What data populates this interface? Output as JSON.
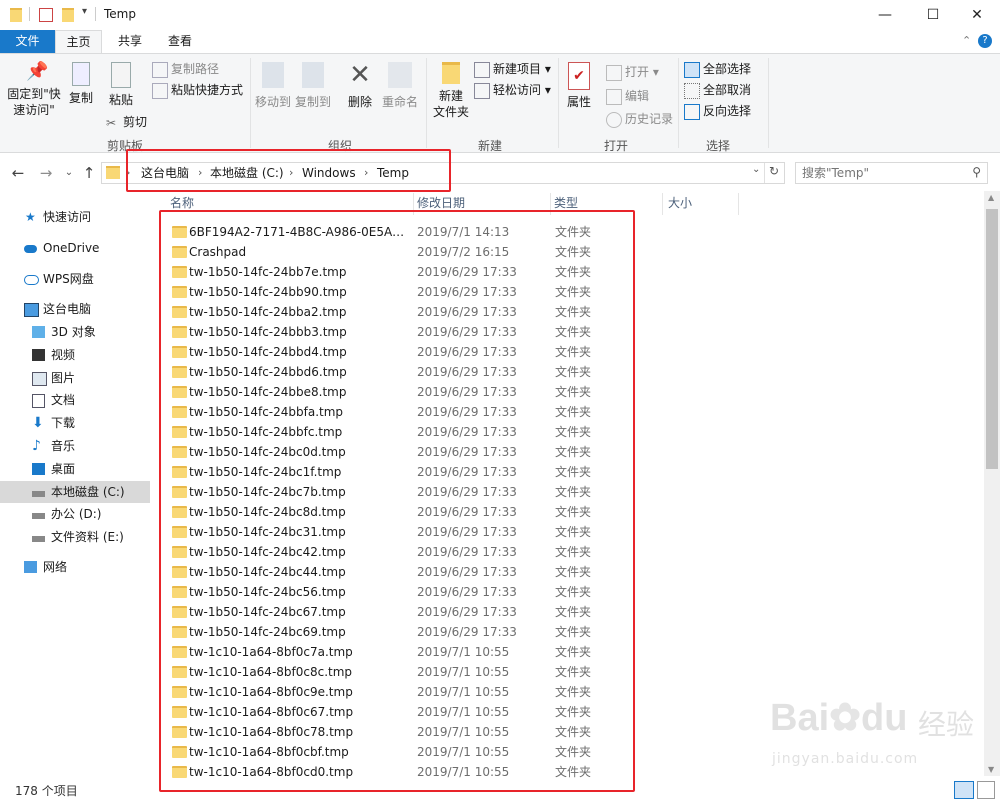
{
  "window": {
    "title": "Temp",
    "minimize": "—",
    "maximize": "☐",
    "close": "✕"
  },
  "tabs": {
    "file": "文件",
    "home": "主页",
    "share": "共享",
    "view": "查看"
  },
  "ribbon": {
    "pin": "固定到\"快\n速访问\"",
    "copy": "复制",
    "paste": "粘贴",
    "copy_path": "复制路径",
    "paste_shortcut": "粘贴快捷方式",
    "cut": "剪切",
    "clipboard": "剪贴板",
    "move_to": "移动到",
    "copy_to": "复制到",
    "delete": "删除",
    "rename": "重命名",
    "organize": "组织",
    "new_folder": "新建\n文件夹",
    "new_item": "新建项目",
    "easy_access": "轻松访问",
    "new_group": "新建",
    "properties": "属性",
    "open": "打开",
    "edit": "编辑",
    "history": "历史记录",
    "open_group": "打开",
    "select_all": "全部选择",
    "select_none": "全部取消",
    "invert_selection": "反向选择",
    "select_group": "选择"
  },
  "address": {
    "crumbs": [
      "这台电脑",
      "本地磁盘 (C:)",
      "Windows",
      "Temp"
    ],
    "search_placeholder": "搜索\"Temp\""
  },
  "sidebar": {
    "items": [
      {
        "label": "快速访问",
        "icon": "star-icon"
      },
      {
        "label": "OneDrive",
        "icon": "cloud-icon"
      },
      {
        "label": "WPS网盘",
        "icon": "wps-cloud-icon"
      },
      {
        "label": "这台电脑",
        "icon": "computer-icon"
      },
      {
        "label": "3D 对象",
        "icon": "cube-icon"
      },
      {
        "label": "视频",
        "icon": "video-icon"
      },
      {
        "label": "图片",
        "icon": "picture-icon"
      },
      {
        "label": "文档",
        "icon": "document-icon"
      },
      {
        "label": "下载",
        "icon": "download-icon"
      },
      {
        "label": "音乐",
        "icon": "music-icon"
      },
      {
        "label": "桌面",
        "icon": "desktop-icon"
      },
      {
        "label": "本地磁盘 (C:)",
        "icon": "drive-icon"
      },
      {
        "label": "办公 (D:)",
        "icon": "drive-icon"
      },
      {
        "label": "文件资料 (E:)",
        "icon": "drive-icon"
      },
      {
        "label": "网络",
        "icon": "network-icon"
      }
    ]
  },
  "columns": {
    "name": "名称",
    "modified": "修改日期",
    "type": "类型",
    "size": "大小"
  },
  "files": [
    {
      "name": "6BF194A2-7171-4B8C-A986-0E5A5AE...",
      "date": "2019/7/1 14:13",
      "type": "文件夹"
    },
    {
      "name": "Crashpad",
      "date": "2019/7/2 16:15",
      "type": "文件夹"
    },
    {
      "name": "tw-1b50-14fc-24bb7e.tmp",
      "date": "2019/6/29 17:33",
      "type": "文件夹"
    },
    {
      "name": "tw-1b50-14fc-24bb90.tmp",
      "date": "2019/6/29 17:33",
      "type": "文件夹"
    },
    {
      "name": "tw-1b50-14fc-24bba2.tmp",
      "date": "2019/6/29 17:33",
      "type": "文件夹"
    },
    {
      "name": "tw-1b50-14fc-24bbb3.tmp",
      "date": "2019/6/29 17:33",
      "type": "文件夹"
    },
    {
      "name": "tw-1b50-14fc-24bbd4.tmp",
      "date": "2019/6/29 17:33",
      "type": "文件夹"
    },
    {
      "name": "tw-1b50-14fc-24bbd6.tmp",
      "date": "2019/6/29 17:33",
      "type": "文件夹"
    },
    {
      "name": "tw-1b50-14fc-24bbe8.tmp",
      "date": "2019/6/29 17:33",
      "type": "文件夹"
    },
    {
      "name": "tw-1b50-14fc-24bbfa.tmp",
      "date": "2019/6/29 17:33",
      "type": "文件夹"
    },
    {
      "name": "tw-1b50-14fc-24bbfc.tmp",
      "date": "2019/6/29 17:33",
      "type": "文件夹"
    },
    {
      "name": "tw-1b50-14fc-24bc0d.tmp",
      "date": "2019/6/29 17:33",
      "type": "文件夹"
    },
    {
      "name": "tw-1b50-14fc-24bc1f.tmp",
      "date": "2019/6/29 17:33",
      "type": "文件夹"
    },
    {
      "name": "tw-1b50-14fc-24bc7b.tmp",
      "date": "2019/6/29 17:33",
      "type": "文件夹"
    },
    {
      "name": "tw-1b50-14fc-24bc8d.tmp",
      "date": "2019/6/29 17:33",
      "type": "文件夹"
    },
    {
      "name": "tw-1b50-14fc-24bc31.tmp",
      "date": "2019/6/29 17:33",
      "type": "文件夹"
    },
    {
      "name": "tw-1b50-14fc-24bc42.tmp",
      "date": "2019/6/29 17:33",
      "type": "文件夹"
    },
    {
      "name": "tw-1b50-14fc-24bc44.tmp",
      "date": "2019/6/29 17:33",
      "type": "文件夹"
    },
    {
      "name": "tw-1b50-14fc-24bc56.tmp",
      "date": "2019/6/29 17:33",
      "type": "文件夹"
    },
    {
      "name": "tw-1b50-14fc-24bc67.tmp",
      "date": "2019/6/29 17:33",
      "type": "文件夹"
    },
    {
      "name": "tw-1b50-14fc-24bc69.tmp",
      "date": "2019/6/29 17:33",
      "type": "文件夹"
    },
    {
      "name": "tw-1c10-1a64-8bf0c7a.tmp",
      "date": "2019/7/1 10:55",
      "type": "文件夹"
    },
    {
      "name": "tw-1c10-1a64-8bf0c8c.tmp",
      "date": "2019/7/1 10:55",
      "type": "文件夹"
    },
    {
      "name": "tw-1c10-1a64-8bf0c9e.tmp",
      "date": "2019/7/1 10:55",
      "type": "文件夹"
    },
    {
      "name": "tw-1c10-1a64-8bf0c67.tmp",
      "date": "2019/7/1 10:55",
      "type": "文件夹"
    },
    {
      "name": "tw-1c10-1a64-8bf0c78.tmp",
      "date": "2019/7/1 10:55",
      "type": "文件夹"
    },
    {
      "name": "tw-1c10-1a64-8bf0cbf.tmp",
      "date": "2019/7/1 10:55",
      "type": "文件夹"
    },
    {
      "name": "tw-1c10-1a64-8bf0cd0.tmp",
      "date": "2019/7/1 10:55",
      "type": "文件夹"
    }
  ],
  "status": {
    "item_count": "178 个项目"
  },
  "watermark": {
    "brand": "Bai",
    "brand2": "du",
    "brand_cn": "经验",
    "url": "jingyan.baidu.com"
  },
  "colors": {
    "accent": "#1979ca",
    "annotation": "#e8242a",
    "folder": "#f9d875"
  }
}
